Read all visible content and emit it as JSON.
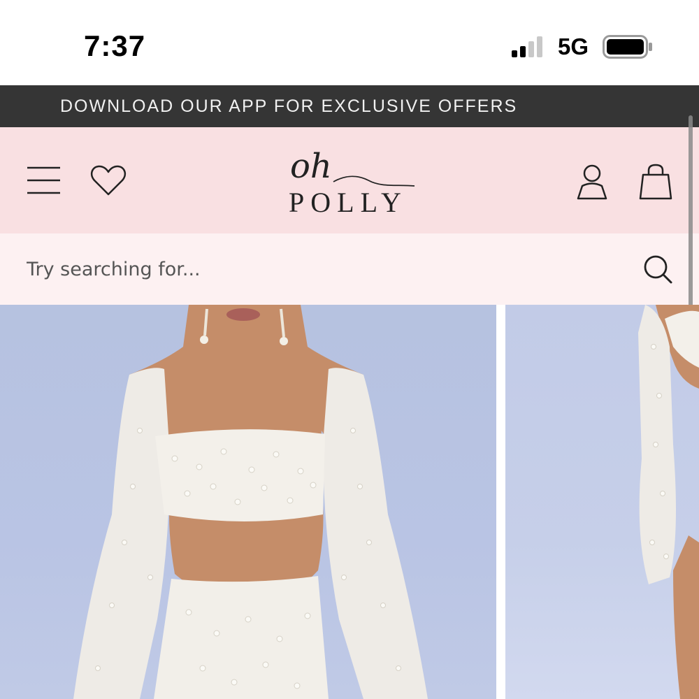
{
  "status_bar": {
    "time": "7:37",
    "network": "5G",
    "signal_icon": "cellular-signal-icon",
    "battery_icon": "battery-icon"
  },
  "promo_banner": {
    "text": "DOWNLOAD OUR APP FOR EXCLUSIVE OFFERS"
  },
  "header": {
    "menu_icon": "hamburger-menu-icon",
    "wishlist_icon": "heart-icon",
    "logo_script": "oh",
    "logo_word": "POLLY",
    "account_icon": "user-icon",
    "bag_icon": "shopping-bag-icon"
  },
  "search": {
    "placeholder": "Try searching for...",
    "icon": "search-icon"
  },
  "colors": {
    "promo_bg": "#353535",
    "header_bg": "#f9e0e2",
    "search_bg": "#fdf1f2",
    "product_bg": "#b9c4e4"
  },
  "products": [
    {
      "image": "model wearing white pearl-embellished long-sleeve crop top and skirt"
    },
    {
      "image": "model in white pearl-embellished outfit, side view"
    }
  ]
}
